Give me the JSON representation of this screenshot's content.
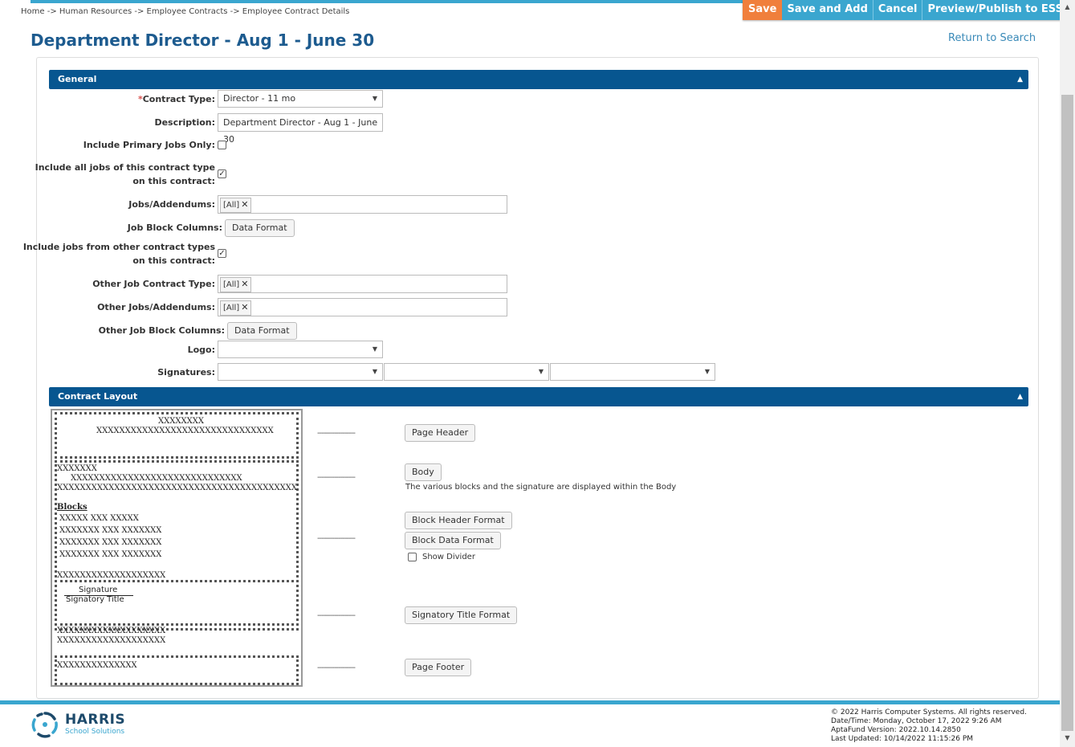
{
  "breadcrumb": "Home -> Human Resources -> Employee Contracts -> Employee Contract Details",
  "actions": {
    "save": "Save",
    "save_add": "Save and Add",
    "cancel": "Cancel",
    "preview": "Preview/Publish to ESS"
  },
  "page_title": "Department Director - Aug 1 - June 30",
  "return_link": "Return to Search",
  "general": {
    "header": "General",
    "contract_type": {
      "required_mark": "*",
      "label": "Contract Type:",
      "value": "Director - 11 mo"
    },
    "description": {
      "label": "Description:",
      "value": "Department Director - Aug 1 - June 30"
    },
    "include_primary": {
      "label": "Include Primary Jobs Only:",
      "checked": false
    },
    "include_all": {
      "label1": "Include all jobs of this contract type",
      "label2": "on this contract:",
      "checked": true
    },
    "jobs_addendums": {
      "label": "Jobs/Addendums:",
      "tag": "[All]"
    },
    "job_block_columns": {
      "label": "Job Block Columns:",
      "button": "Data Format"
    },
    "include_other": {
      "label1": "Include jobs from other contract types",
      "label2": "on this contract:",
      "checked": true
    },
    "other_contract_type": {
      "label": "Other Job Contract Type:",
      "tag": "[All]"
    },
    "other_jobs": {
      "label": "Other Jobs/Addendums:",
      "tag": "[All]"
    },
    "other_block_columns": {
      "label": "Other Job Block Columns:",
      "button": "Data Format"
    },
    "logo": {
      "label": "Logo:",
      "value": ""
    },
    "signatures": {
      "label": "Signatures:",
      "values": [
        "",
        "",
        ""
      ]
    }
  },
  "contract_layout": {
    "header": "Contract Layout",
    "preview": {
      "header_line1": "XXXXXXXX",
      "header_line2": "XXXXXXXXXXXXXXXXXXXXXXXXXXXXXXX",
      "body_line1": "XXXXXXX",
      "body_line2": "XXXXXXXXXXXXXXXXXXXXXXXXXXXXXX",
      "body_line3": "XXXXXXXXXXXXXXXXXXXXXXXXXXXXXXXXXXXXXXXXXX",
      "blocks_label": "Blocks",
      "block_header": "XXXXX    XXX XXXXX",
      "block_rows": [
        "XXXXXXX XXX XXXXXXX",
        "XXXXXXX XXX XXXXXXX",
        "XXXXXXX XXX XXXXXXX"
      ],
      "body_tail": "XXXXXXXXXXXXXXXXXXX",
      "signature_label": "Signature",
      "signatory_title": "Signatory Title",
      "post_sig1": "XXXXXXXXXXXXXXXXXXX",
      "post_sig2": "XXXXXXXXXXXXXXXXXXX",
      "footer_line": "XXXXXXXXXXXXXX"
    },
    "dashes": "------------------",
    "buttons": {
      "page_header": "Page Header",
      "body": "Body",
      "block_header_format": "Block Header Format",
      "block_data_format": "Block Data Format",
      "signatory_title_format": "Signatory Title Format",
      "page_footer": "Page Footer"
    },
    "body_hint": "The various blocks and the signature are displayed within the Body",
    "show_divider": {
      "label": "Show Divider",
      "checked": false
    }
  },
  "footer": {
    "logo_name": "HARRIS",
    "logo_sub": "School Solutions",
    "copyright": "© 2022 Harris Computer Systems. All rights reserved.",
    "datetime": "Date/Time: Monday, October 17, 2022 9:26 AM",
    "version": "AptaFund Version: 2022.10.14.2850",
    "updated": "Last Updated: 10/14/2022 11:15:26 PM"
  },
  "colors": {
    "accent": "#3aa6cf",
    "save": "#f07f3c",
    "section": "#075690",
    "title": "#1d5b8f"
  }
}
